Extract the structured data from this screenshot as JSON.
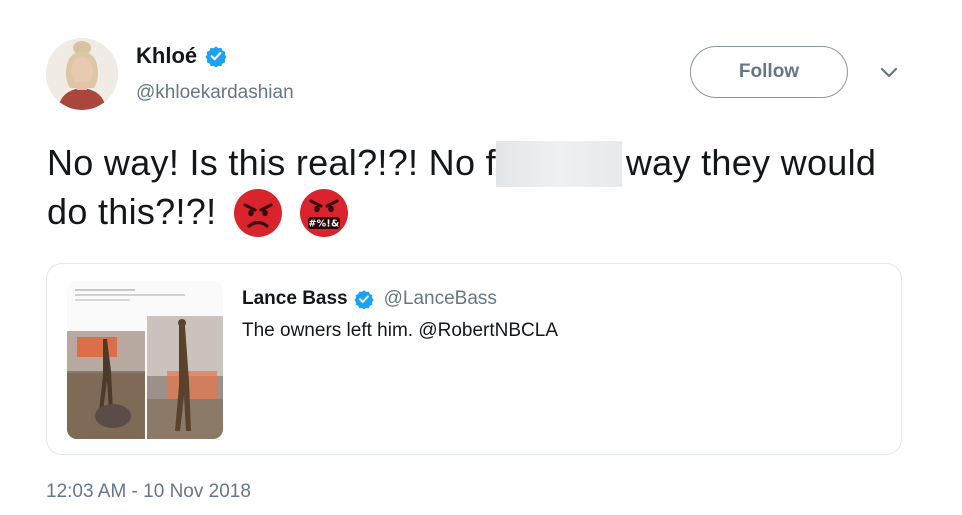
{
  "author": {
    "name": "Khloé",
    "handle": "@khloekardashian",
    "verified": true
  },
  "follow_label": "Follow",
  "tweet": {
    "text_part1": "No way! Is this real?!?! No f",
    "text_part2": "way they would do this?!?!",
    "emojis": [
      "angry-face",
      "swearing-face"
    ],
    "swearing_symbols": "#%!&"
  },
  "quote": {
    "name": "Lance Bass",
    "handle": "@LanceBass",
    "verified": true,
    "text": "The owners left him. @RobertNBCLA"
  },
  "timestamp": "12:03 AM - 10 Nov 2018",
  "colors": {
    "verified_blue": "#1da1f2",
    "secondary_text": "#657786",
    "emoji_red": "#d9232d"
  }
}
